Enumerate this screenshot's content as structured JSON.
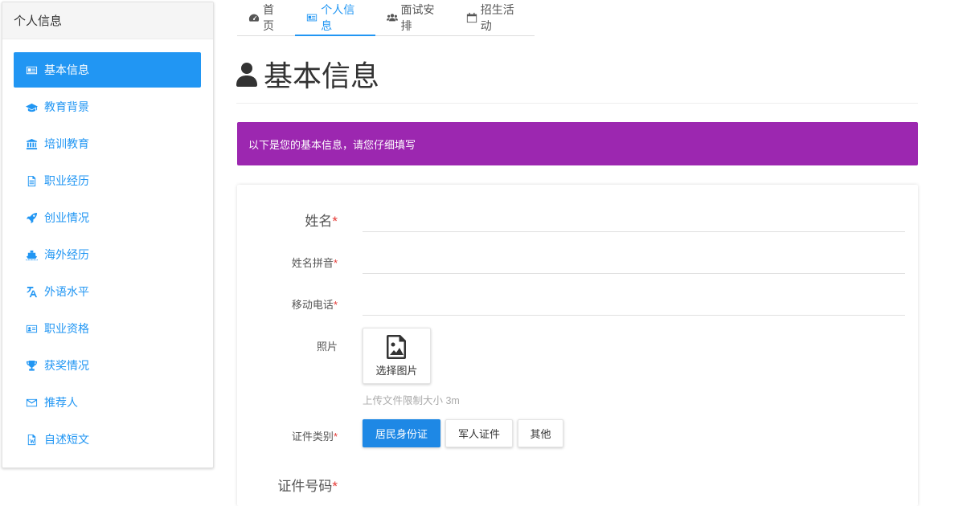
{
  "sidebar": {
    "title": "个人信息",
    "items": [
      {
        "label": "基本信息",
        "icon": "id-card-icon",
        "active": true
      },
      {
        "label": "教育背景",
        "icon": "graduation-cap-icon"
      },
      {
        "label": "培训教育",
        "icon": "institution-icon"
      },
      {
        "label": "职业经历",
        "icon": "document-icon"
      },
      {
        "label": "创业情况",
        "icon": "rocket-icon"
      },
      {
        "label": "海外经历",
        "icon": "ship-icon"
      },
      {
        "label": "外语水平",
        "icon": "language-icon"
      },
      {
        "label": "职业资格",
        "icon": "certificate-card-icon"
      },
      {
        "label": "获奖情况",
        "icon": "trophy-icon"
      },
      {
        "label": "推荐人",
        "icon": "envelope-icon"
      },
      {
        "label": "自述短文",
        "icon": "word-file-icon"
      }
    ]
  },
  "tabs": [
    {
      "label": "首页",
      "icon": "dashboard-icon"
    },
    {
      "label": "个人信息",
      "icon": "id-card-icon",
      "active": true
    },
    {
      "label": "面试安排",
      "icon": "users-icon"
    },
    {
      "label": "招生活动",
      "icon": "calendar-icon"
    }
  ],
  "page": {
    "title": "基本信息",
    "title_icon": "user-icon"
  },
  "alert": {
    "text": "以下是您的基本信息，请您仔细填写"
  },
  "form": {
    "required_mark": "*",
    "name_label": "姓名",
    "pinyin_label": "姓名拼音",
    "mobile_label": "移动电话",
    "photo_label": "照片",
    "photo_button": "选择图片",
    "photo_hint": "上传文件限制大小 3m",
    "id_type_label": "证件类别",
    "id_type_options": [
      "居民身份证",
      "军人证件",
      "其他"
    ],
    "id_type_selected": "居民身份证",
    "id_number_label": "证件号码"
  },
  "colors": {
    "accent": "#2196f3",
    "alert_bg": "#9c27b0",
    "required": "#e53935"
  }
}
